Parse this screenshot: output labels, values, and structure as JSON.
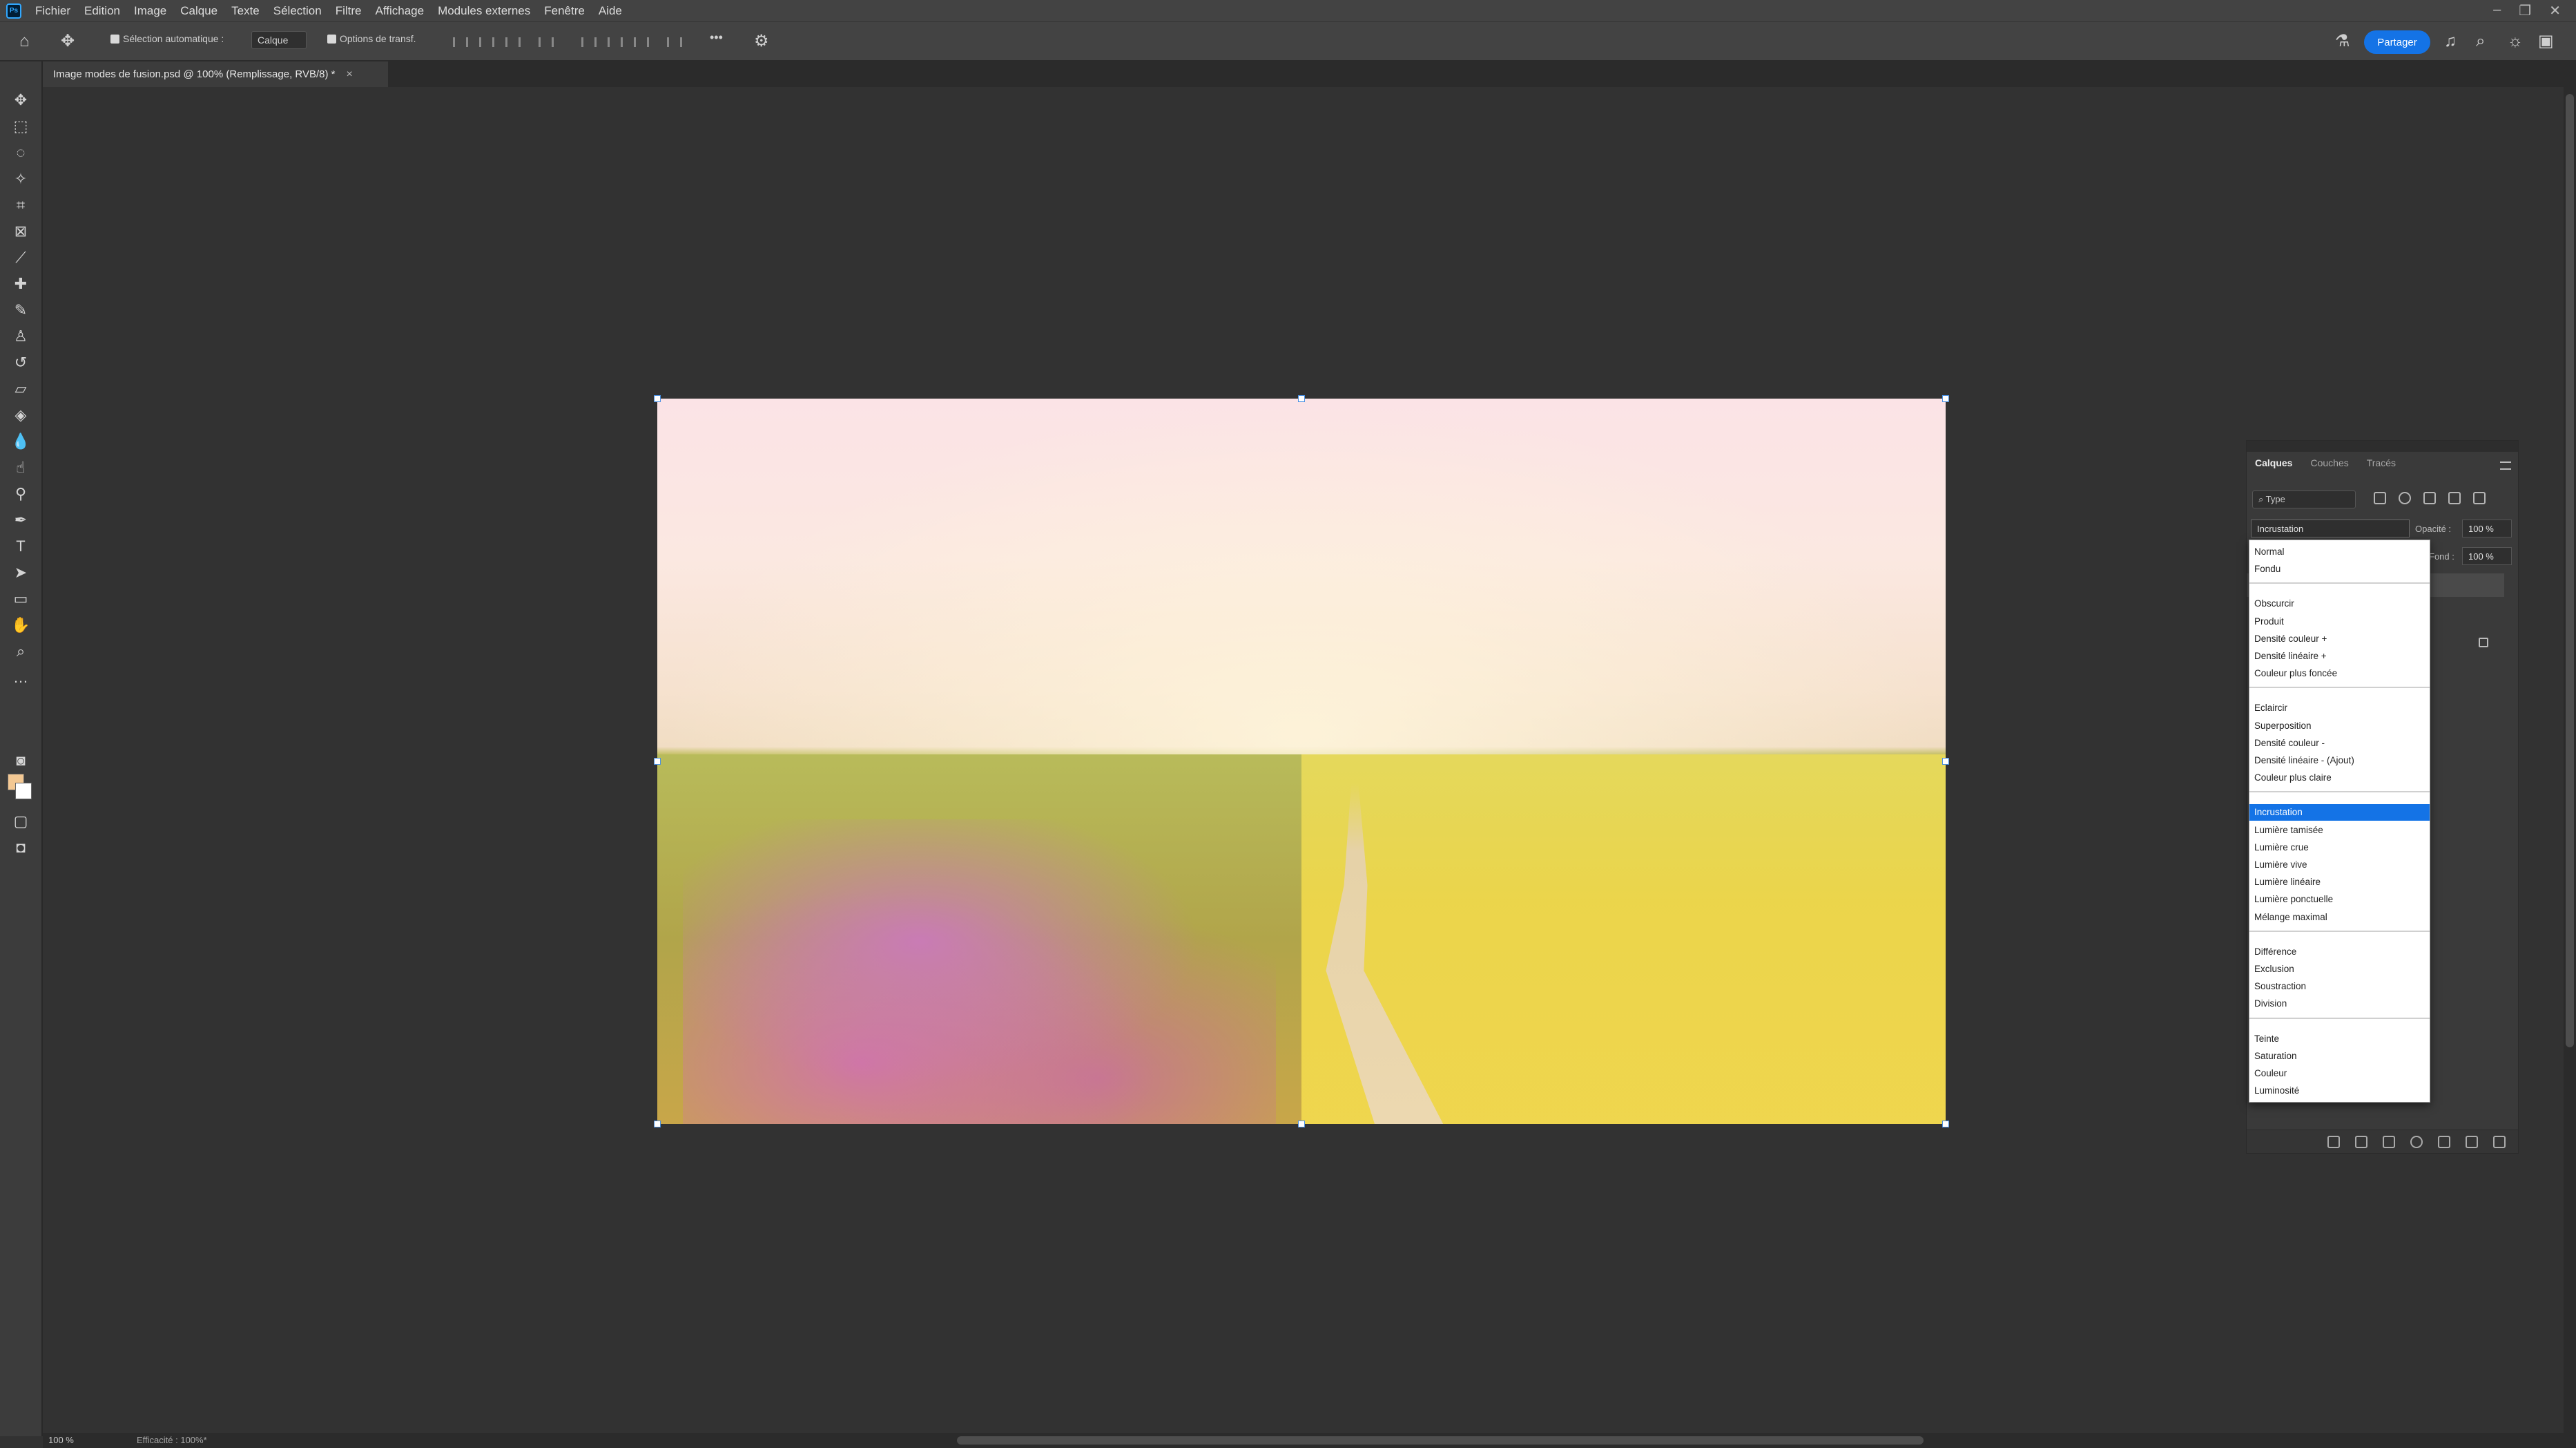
{
  "app": {
    "logo": "Ps"
  },
  "menu": [
    "Fichier",
    "Edition",
    "Image",
    "Calque",
    "Texte",
    "Sélection",
    "Filtre",
    "Affichage",
    "Modules externes",
    "Fenêtre",
    "Aide"
  ],
  "options": {
    "auto_select_label": "Sélection automatique :",
    "auto_select_value": "Calque",
    "transform_label": "Options de transf.",
    "more_label": "•••",
    "share_label": "Partager"
  },
  "document": {
    "tab_title": "Image modes de fusion.psd @ 100% (Remplissage, RVB/8) *",
    "close": "×"
  },
  "layers_panel": {
    "tabs": [
      "Calques",
      "Couches",
      "Tracés"
    ],
    "filter_placeholder": "Type",
    "blend_mode": "Incrustation",
    "opacity_label": "Opacité :",
    "opacity_value": "100 %",
    "fill_label": "Fond :",
    "fill_value": "100 %"
  },
  "blend_modes": {
    "selected": "Incrustation",
    "groups": [
      [
        "Normal",
        "Fondu"
      ],
      [
        "Obscurcir",
        "Produit",
        "Densité couleur +",
        "Densité linéaire +",
        "Couleur plus foncée"
      ],
      [
        "Eclaircir",
        "Superposition",
        "Densité couleur -",
        "Densité linéaire - (Ajout)",
        "Couleur plus claire"
      ],
      [
        "Incrustation",
        "Lumière tamisée",
        "Lumière crue",
        "Lumière vive",
        "Lumière linéaire",
        "Lumière ponctuelle",
        "Mélange maximal"
      ],
      [
        "Différence",
        "Exclusion",
        "Soustraction",
        "Division"
      ],
      [
        "Teinte",
        "Saturation",
        "Couleur",
        "Luminosité"
      ]
    ]
  },
  "status": {
    "zoom": "100 %",
    "efficiency": "Efficacité : 100%*"
  },
  "colors": {
    "foreground": "#f3c893",
    "background": "#ffffff",
    "accent": "#1473e6"
  }
}
